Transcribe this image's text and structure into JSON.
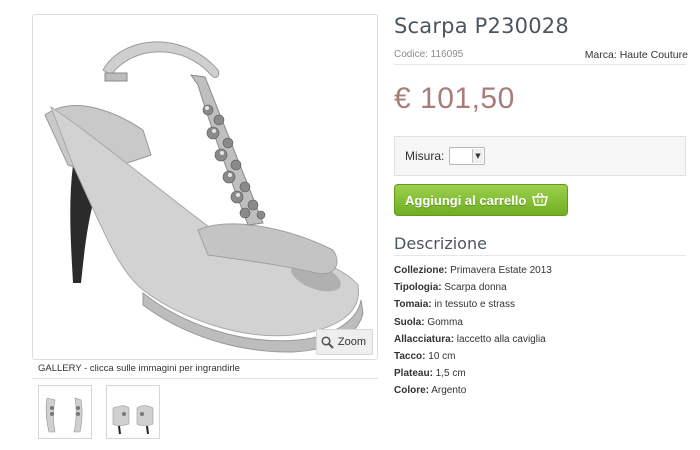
{
  "gallery": {
    "caption": "GALLERY - clicca sulle immagini per ingrandirle",
    "zoom_label": "Zoom"
  },
  "product": {
    "title": "Scarpa P230028",
    "code": "Codice: 116095",
    "brand": "Marca: Haute Couture",
    "price": "€ 101,50",
    "size_label": "Misura:",
    "size_value": "",
    "cart_label": "Aggiungi al carrello"
  },
  "description": {
    "title": "Descrizione",
    "attributes": [
      {
        "key": "Collezione:",
        "value": "Primavera Estate 2013"
      },
      {
        "key": "Tipologia:",
        "value": "Scarpa donna"
      },
      {
        "key": "Tomaia:",
        "value": "in tessuto e strass"
      },
      {
        "key": "Suola:",
        "value": "Gomma"
      },
      {
        "key": "Allacciatura:",
        "value": "laccetto alla caviglia"
      },
      {
        "key": "Tacco:",
        "value": "10 cm"
      },
      {
        "key": "Plateau:",
        "value": "1,5  cm"
      },
      {
        "key": "Colore:",
        "value": "Argento"
      }
    ]
  },
  "colors": {
    "price": "#a87c79",
    "cart_button": "#7ab82c",
    "title": "#4a5560"
  },
  "icons": [
    "zoom-icon",
    "cart-icon",
    "select-arrow-icon"
  ]
}
